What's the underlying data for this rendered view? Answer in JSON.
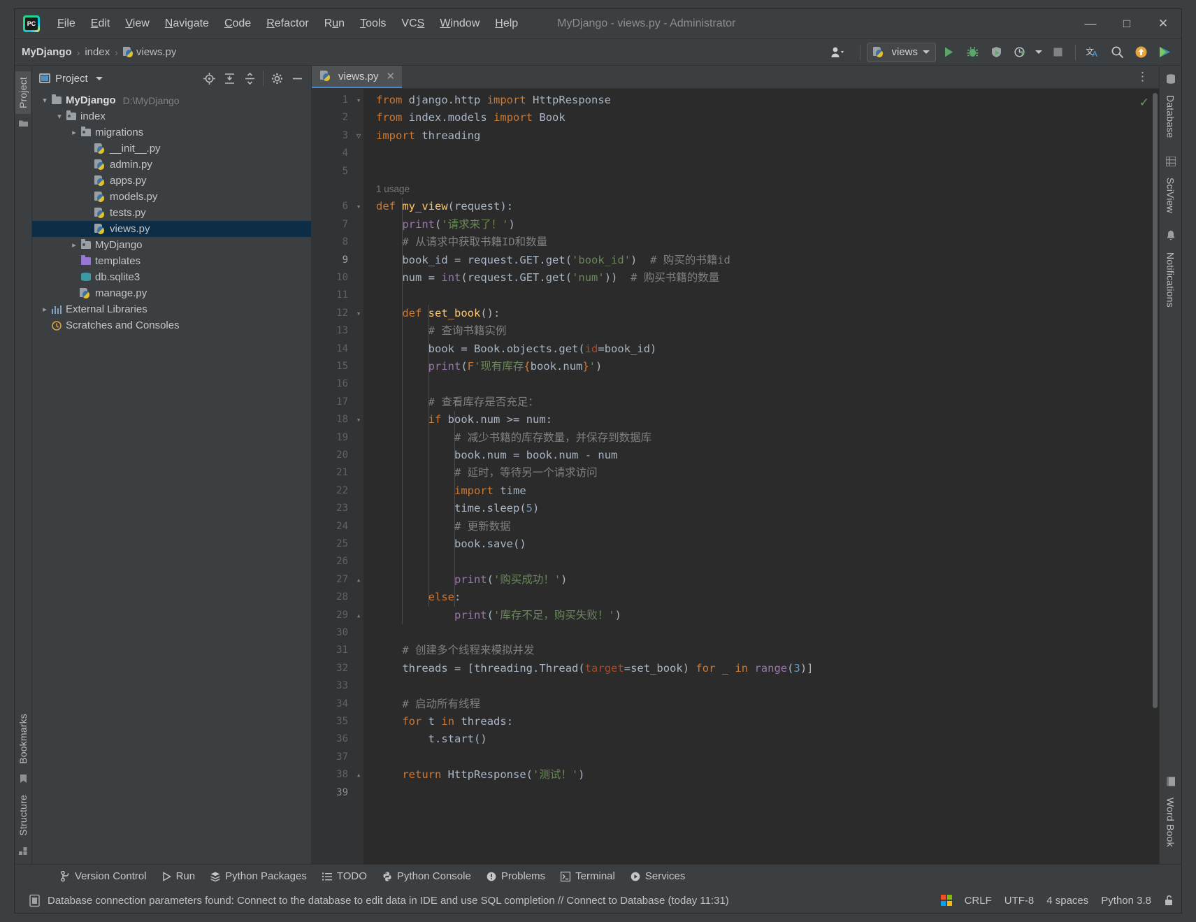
{
  "window": {
    "title": "MyDjango - views.py - Administrator",
    "minimize_label": "—",
    "maximize_label": "□",
    "close_label": "✕"
  },
  "menubar": [
    {
      "label": "File",
      "mnemonic": "F"
    },
    {
      "label": "Edit",
      "mnemonic": "E"
    },
    {
      "label": "View",
      "mnemonic": "V"
    },
    {
      "label": "Navigate",
      "mnemonic": "N"
    },
    {
      "label": "Code",
      "mnemonic": "C"
    },
    {
      "label": "Refactor",
      "mnemonic": "R"
    },
    {
      "label": "Run",
      "mnemonic": "u"
    },
    {
      "label": "Tools",
      "mnemonic": "T"
    },
    {
      "label": "VCS",
      "mnemonic": "S"
    },
    {
      "label": "Window",
      "mnemonic": "W"
    },
    {
      "label": "Help",
      "mnemonic": "H"
    }
  ],
  "breadcrumb": {
    "items": [
      "MyDjango",
      "index",
      "views.py"
    ],
    "separator": "›"
  },
  "toolbar": {
    "run_config": "views",
    "run_label": "Run",
    "debug_label": "Debug",
    "coverage_label": "Run with Coverage",
    "profile_label": "Profile",
    "stop_label": "Stop",
    "translate_label": "Translate",
    "search_label": "Search Everywhere",
    "update_label": "Update Project",
    "share_label": "Share"
  },
  "left_strip": {
    "project_tab": "Project",
    "bookmarks_tab": "Bookmarks",
    "structure_tab": "Structure"
  },
  "right_strip": {
    "database_tab": "Database",
    "sciview_tab": "SciView",
    "notifications_tab": "Notifications",
    "wordbook_tab": "Word Book"
  },
  "project_panel": {
    "title": "Project",
    "tools": [
      "select-opened-file",
      "expand-all",
      "collapse-all",
      "settings",
      "hide"
    ],
    "tree": [
      {
        "label": "MyDjango",
        "path": "D:\\MyDjango",
        "icon": "folder",
        "depth": 0,
        "arrow": "down",
        "bold": true,
        "selected": false
      },
      {
        "label": "index",
        "path": "",
        "icon": "folder-module",
        "depth": 1,
        "arrow": "down",
        "bold": false,
        "selected": false
      },
      {
        "label": "migrations",
        "path": "",
        "icon": "folder-module",
        "depth": 2,
        "arrow": "right",
        "bold": false,
        "selected": false
      },
      {
        "label": "__init__.py",
        "path": "",
        "icon": "python",
        "depth": 3,
        "arrow": "none",
        "bold": false,
        "selected": false
      },
      {
        "label": "admin.py",
        "path": "",
        "icon": "python",
        "depth": 3,
        "arrow": "none",
        "bold": false,
        "selected": false
      },
      {
        "label": "apps.py",
        "path": "",
        "icon": "python",
        "depth": 3,
        "arrow": "none",
        "bold": false,
        "selected": false
      },
      {
        "label": "models.py",
        "path": "",
        "icon": "python",
        "depth": 3,
        "arrow": "none",
        "bold": false,
        "selected": false
      },
      {
        "label": "tests.py",
        "path": "",
        "icon": "python",
        "depth": 3,
        "arrow": "none",
        "bold": false,
        "selected": false
      },
      {
        "label": "views.py",
        "path": "",
        "icon": "python",
        "depth": 3,
        "arrow": "none",
        "bold": false,
        "selected": true
      },
      {
        "label": "MyDjango",
        "path": "",
        "icon": "folder-module",
        "depth": 2,
        "arrow": "right",
        "bold": false,
        "selected": false
      },
      {
        "label": "templates",
        "path": "",
        "icon": "folder-purple",
        "depth": 2,
        "arrow": "none",
        "bold": false,
        "selected": false
      },
      {
        "label": "db.sqlite3",
        "path": "",
        "icon": "database",
        "depth": 2,
        "arrow": "none",
        "bold": false,
        "selected": false
      },
      {
        "label": "manage.py",
        "path": "",
        "icon": "python",
        "depth": 2,
        "arrow": "none",
        "bold": false,
        "selected": false
      },
      {
        "label": "External Libraries",
        "path": "",
        "icon": "library",
        "depth": 0,
        "arrow": "right",
        "bold": false,
        "selected": false
      },
      {
        "label": "Scratches and Consoles",
        "path": "",
        "icon": "scratches",
        "depth": 0,
        "arrow": "none",
        "bold": false,
        "selected": false
      }
    ]
  },
  "editor": {
    "tab_label": "views.py",
    "close_label": "✕",
    "inspection_status": "✓",
    "usage_hint": "1 usage",
    "usage_hint_line": 5,
    "last_line_number": 39,
    "lines": [
      {
        "n": 1,
        "fold": "start"
      },
      {
        "n": 2,
        "fold": ""
      },
      {
        "n": 3,
        "fold": "single"
      },
      {
        "n": 4,
        "fold": ""
      },
      {
        "n": 5,
        "fold": ""
      },
      {
        "n": 6,
        "fold": "start"
      },
      {
        "n": 7,
        "fold": ""
      },
      {
        "n": 8,
        "fold": ""
      },
      {
        "n": 9,
        "fold": ""
      },
      {
        "n": 10,
        "fold": ""
      },
      {
        "n": 11,
        "fold": ""
      },
      {
        "n": 12,
        "fold": "start"
      },
      {
        "n": 13,
        "fold": ""
      },
      {
        "n": 14,
        "fold": ""
      },
      {
        "n": 15,
        "fold": ""
      },
      {
        "n": 16,
        "fold": ""
      },
      {
        "n": 17,
        "fold": ""
      },
      {
        "n": 18,
        "fold": "start"
      },
      {
        "n": 19,
        "fold": ""
      },
      {
        "n": 20,
        "fold": ""
      },
      {
        "n": 21,
        "fold": ""
      },
      {
        "n": 22,
        "fold": ""
      },
      {
        "n": 23,
        "fold": ""
      },
      {
        "n": 24,
        "fold": ""
      },
      {
        "n": 25,
        "fold": ""
      },
      {
        "n": 26,
        "fold": ""
      },
      {
        "n": 27,
        "fold": "end"
      },
      {
        "n": 28,
        "fold": ""
      },
      {
        "n": 29,
        "fold": "end"
      },
      {
        "n": 30,
        "fold": ""
      },
      {
        "n": 31,
        "fold": ""
      },
      {
        "n": 32,
        "fold": ""
      },
      {
        "n": 33,
        "fold": ""
      },
      {
        "n": 34,
        "fold": ""
      },
      {
        "n": 35,
        "fold": ""
      },
      {
        "n": 36,
        "fold": ""
      },
      {
        "n": 37,
        "fold": ""
      },
      {
        "n": 38,
        "fold": "end"
      }
    ],
    "source": [
      "from django.http import HttpResponse",
      "from index.models import Book",
      "import threading",
      "",
      "",
      "def my_view(request):",
      "    print('请求来了！')",
      "    # 从请求中获取书籍ID和数量",
      "    book_id = request.GET.get('book_id')  # 购买的书籍id",
      "    num = int(request.GET.get('num'))  # 购买书籍的数量",
      "",
      "    def set_book():",
      "        # 查询书籍实例",
      "        book = Book.objects.get(id=book_id)",
      "        print(F'现有库存{book.num}')",
      "",
      "        # 查看库存是否充足：",
      "        if book.num >= num:",
      "            # 减少书籍的库存数量，并保存到数据库",
      "            book.num = book.num - num",
      "            # 延时，等待另一个请求访问",
      "            import time",
      "            time.sleep(5)",
      "            # 更新数据",
      "            book.save()",
      "",
      "            print('购买成功！')",
      "        else:",
      "            print('库存不足，购买失败！')",
      "",
      "    # 创建多个线程来模拟并发",
      "    threads = [threading.Thread(target=set_book) for _ in range(3)]",
      "",
      "    # 启动所有线程",
      "    for t in threads:",
      "        t.start()",
      "",
      "    return HttpResponse('测试！')"
    ]
  },
  "bottom_tools": [
    {
      "label": "Version Control",
      "icon": "branch-icon"
    },
    {
      "label": "Run",
      "icon": "play-icon"
    },
    {
      "label": "Python Packages",
      "icon": "packages-icon"
    },
    {
      "label": "TODO",
      "icon": "list-icon"
    },
    {
      "label": "Python Console",
      "icon": "python-icon"
    },
    {
      "label": "Problems",
      "icon": "warning-icon"
    },
    {
      "label": "Terminal",
      "icon": "terminal-icon"
    },
    {
      "label": "Services",
      "icon": "services-icon"
    }
  ],
  "statusbar": {
    "message": "Database connection parameters found: Connect to the database to edit data in IDE and use SQL completion // Connect to Database (today 11:31)",
    "line_separator": "CRLF",
    "encoding": "UTF-8",
    "indent": "4 spaces",
    "interpreter": "Python 3.8",
    "lock_icon": "unlocked-icon"
  },
  "colors": {
    "accent_blue": "#4a88c7",
    "selection": "#0d2d47",
    "editor_bg": "#2b2b2b",
    "panel_bg": "#3c3f41",
    "gutter_bg": "#313335",
    "green": "#59a869",
    "keyword": "#cc7832",
    "string": "#6a8759",
    "comment": "#808080",
    "number": "#6897bb",
    "function": "#ffc66d"
  }
}
